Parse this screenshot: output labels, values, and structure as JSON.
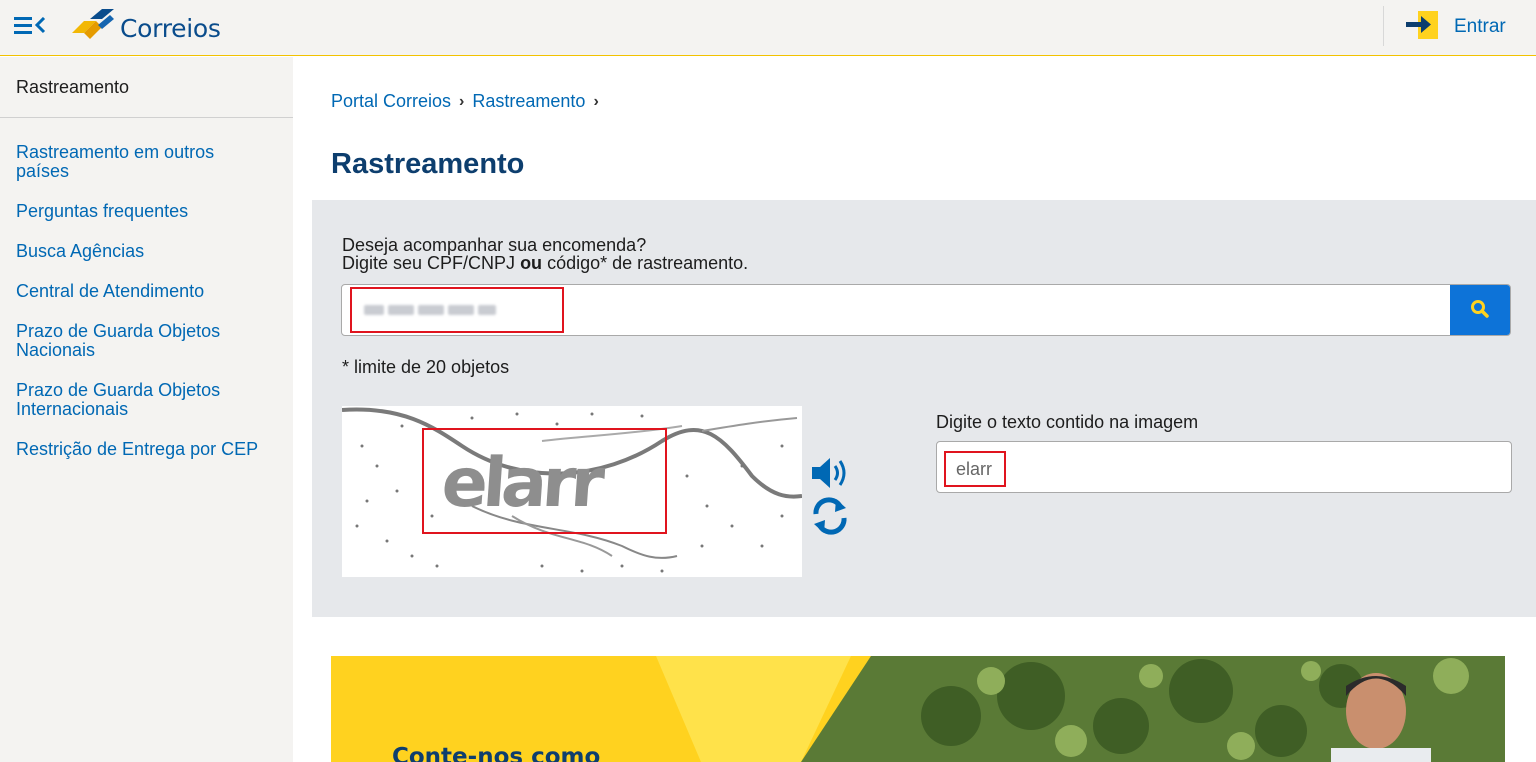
{
  "header": {
    "logo_text": "Correios",
    "login_label": "Entrar"
  },
  "sidebar": {
    "title": "Rastreamento",
    "items": [
      {
        "label": "Rastreamento em outros países"
      },
      {
        "label": "Perguntas frequentes"
      },
      {
        "label": "Busca Agências"
      },
      {
        "label": "Central de Atendimento"
      },
      {
        "label": "Prazo de Guarda Objetos Nacionais"
      },
      {
        "label": "Prazo de Guarda Objetos Internacionais"
      },
      {
        "label": "Restrição de Entrega por CEP"
      }
    ]
  },
  "breadcrumb": {
    "items": [
      "Portal Correios",
      "Rastreamento"
    ],
    "separator": "›"
  },
  "page": {
    "title": "Rastreamento"
  },
  "tracking": {
    "question": "Deseja acompanhar sua encomenda?",
    "instruction_before": "Digite seu CPF/CNPJ ",
    "instruction_bold": "ou",
    "instruction_after": " código* de rastreamento.",
    "input_value": "",
    "limit_note": "* limite de 20 objetos"
  },
  "captcha": {
    "image_text": "elarr",
    "label": "Digite o texto contido na imagem",
    "input_value": "elarr"
  },
  "banner": {
    "heading": "Conte-nos como"
  },
  "colors": {
    "brand_blue": "#0068b4",
    "brand_yellow": "#ffd700",
    "title_navy": "#0d3e6e",
    "search_button": "#0d73d8",
    "highlight_red": "#e0141e",
    "panel_gray": "#e6e8eb"
  },
  "icons": {
    "menu": "menu-collapse-icon",
    "logo": "correios-logo-icon",
    "login": "login-arrow-icon",
    "search": "search-icon",
    "audio": "speaker-icon",
    "refresh": "refresh-icon"
  }
}
